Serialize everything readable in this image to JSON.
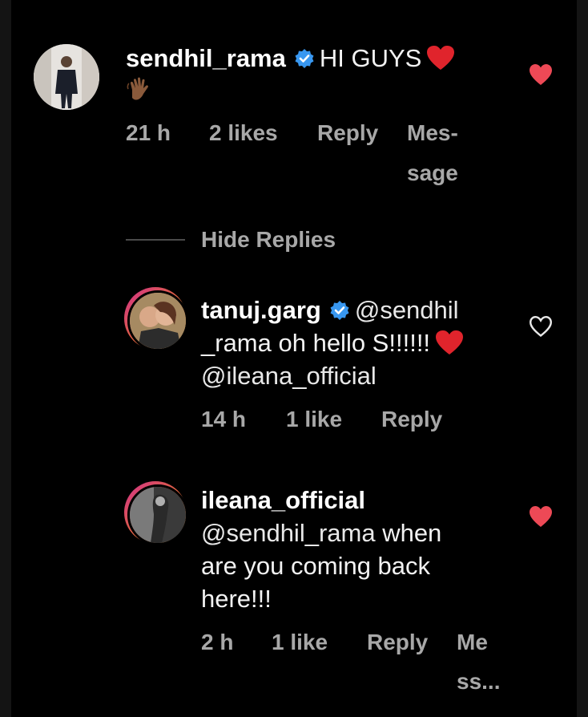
{
  "colors": {
    "background": "#000000",
    "text": "#f2f2f2",
    "meta": "#a8a8a8",
    "heart_filled": "#ed4956",
    "verified": "#3897f0"
  },
  "comments": [
    {
      "username": "sendhil_rama",
      "verified": true,
      "text": "HI GUYS",
      "emoji": [
        "red-heart",
        "waving-hand"
      ],
      "time": "21 h",
      "likes": "2 likes",
      "reply": "Reply",
      "message_line1": "Mes-",
      "message_line2": "sage",
      "liked": true
    },
    {
      "username": "tanuj.garg",
      "verified": true,
      "line1_mention": "@sendhil",
      "line2": "_rama oh hello S!!!!!!",
      "line3": "@ileana_official",
      "time": "14 h",
      "likes": "1 like",
      "reply": "Reply",
      "liked": false
    },
    {
      "username": "ileana_official",
      "verified": false,
      "mention": "@sendhil_rama",
      "line1_rest": " when",
      "line2": "are you coming back",
      "line3": "here!!!",
      "time": "2 h",
      "likes": "1 like",
      "reply": "Reply",
      "message_line1": "Me",
      "message_line2": "ss...",
      "liked": true
    }
  ],
  "hide_replies": "Hide Replies",
  "icons": {
    "verified": "verified-badge-icon",
    "heart_filled": "heart-filled-icon",
    "heart_outline": "heart-outline-icon"
  }
}
